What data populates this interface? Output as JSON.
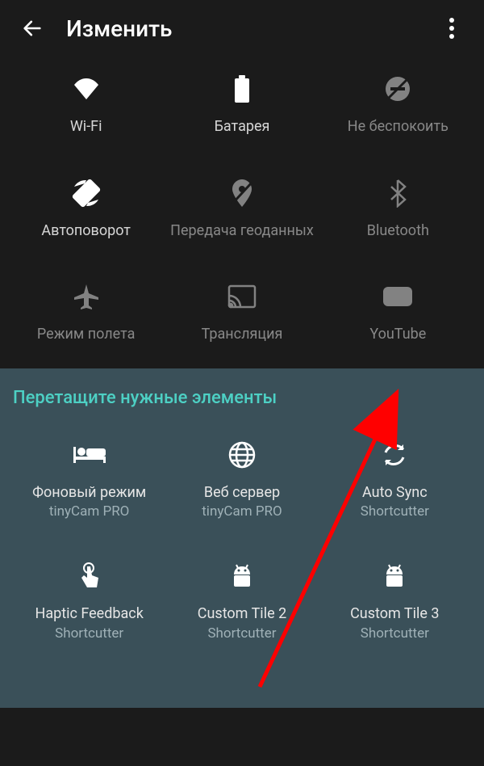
{
  "header": {
    "title": "Изменить"
  },
  "active_tiles": [
    {
      "icon": "wifi",
      "label": "Wi-Fi",
      "dim": false
    },
    {
      "icon": "battery",
      "label": "Батарея",
      "dim": false
    },
    {
      "icon": "dnd",
      "label": "Не беспокоить",
      "dim": true
    },
    {
      "icon": "rotate",
      "label": "Автоповорот",
      "dim": false
    },
    {
      "icon": "location-off",
      "label": "Передача геоданных",
      "dim": true
    },
    {
      "icon": "bluetooth",
      "label": "Bluetooth",
      "dim": true
    },
    {
      "icon": "airplane",
      "label": "Режим полета",
      "dim": true
    },
    {
      "icon": "cast",
      "label": "Трансляция",
      "dim": true
    },
    {
      "icon": "youtube",
      "label": "YouTube",
      "dim": true
    }
  ],
  "drag_section": {
    "title": "Перетащите нужные элементы",
    "tiles": [
      {
        "icon": "bed",
        "label": "Фоновый режим",
        "sub": "tinyCam PRO"
      },
      {
        "icon": "globe",
        "label": "Веб сервер",
        "sub": "tinyCam PRO"
      },
      {
        "icon": "sync",
        "label": "Auto Sync",
        "sub": "Shortcutter"
      },
      {
        "icon": "touch",
        "label": "Haptic Feedback",
        "sub": "Shortcutter"
      },
      {
        "icon": "android",
        "label": "Custom Tile 2",
        "sub": "Shortcutter"
      },
      {
        "icon": "android",
        "label": "Custom Tile 3",
        "sub": "Shortcutter"
      }
    ]
  }
}
